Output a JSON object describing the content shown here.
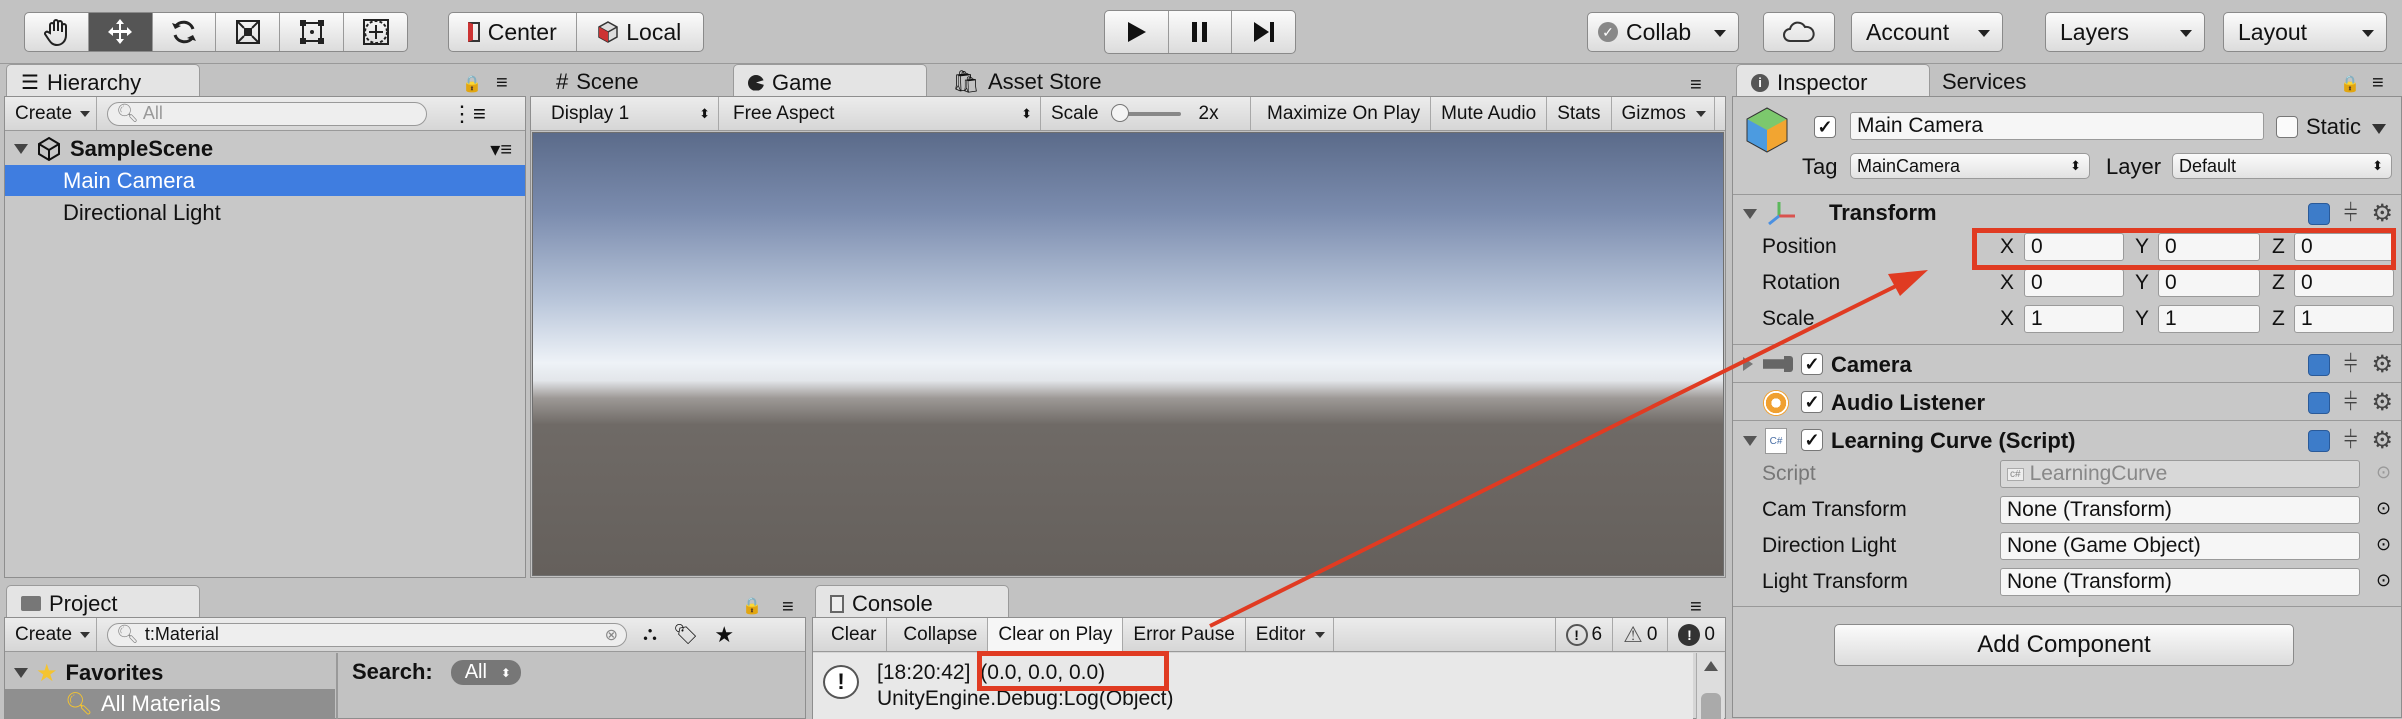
{
  "colors": {
    "accent": "#3f7de0",
    "highlight": "#e03b22"
  },
  "toolbar": {
    "tools": [
      "hand-tool-icon",
      "move-tool-icon",
      "rotate-tool-icon",
      "scale-tool-icon",
      "rect-tool-icon",
      "transform-tool-icon"
    ],
    "pivot_label": "Center",
    "space_label": "Local",
    "collab_label": "Collab",
    "account_label": "Account",
    "layers_label": "Layers",
    "layout_label": "Layout"
  },
  "hierarchy": {
    "tab": "Hierarchy",
    "create": "Create",
    "search_placeholder": "All",
    "scene": "SampleScene",
    "items": [
      "Main Camera",
      "Directional Light"
    ]
  },
  "view_tabs": {
    "scene": "Scene",
    "game": "Game",
    "asset_store": "Asset Store"
  },
  "game_toolbar": {
    "display": "Display 1",
    "aspect": "Free Aspect",
    "scale_label": "Scale",
    "scale_value": "2x",
    "maximize": "Maximize On Play",
    "mute": "Mute Audio",
    "stats": "Stats",
    "gizmos": "Gizmos"
  },
  "project": {
    "tab": "Project",
    "create": "Create",
    "search_value": "t:Material",
    "favorites": "Favorites",
    "all_materials": "All Materials",
    "search_label": "Search:",
    "search_scope": "All"
  },
  "console": {
    "tab": "Console",
    "clear": "Clear",
    "collapse": "Collapse",
    "clear_on_play": "Clear on Play",
    "error_pause": "Error Pause",
    "editor": "Editor",
    "info_count": "6",
    "warn_count": "0",
    "error_count": "0",
    "log_time": "[18:20:42]",
    "log_message": "(0.0, 0.0, 0.0)",
    "log_line2": "UnityEngine.Debug:Log(Object)"
  },
  "inspector": {
    "tab": "Inspector",
    "services_tab": "Services",
    "object_name": "Main Camera",
    "static_label": "Static",
    "tag_label": "Tag",
    "tag_value": "MainCamera",
    "layer_label": "Layer",
    "layer_value": "Default",
    "transform": {
      "title": "Transform",
      "rows": [
        {
          "label": "Position",
          "x": "0",
          "y": "0",
          "z": "0"
        },
        {
          "label": "Rotation",
          "x": "0",
          "y": "0",
          "z": "0"
        },
        {
          "label": "Scale",
          "x": "1",
          "y": "1",
          "z": "1"
        }
      ]
    },
    "camera_title": "Camera",
    "audio_title": "Audio Listener",
    "script_component": {
      "title": "Learning Curve (Script)",
      "script_label": "Script",
      "script_value": "LearningCurve",
      "fields": [
        {
          "label": "Cam Transform",
          "value": "None (Transform)"
        },
        {
          "label": "Direction Light",
          "value": "None (Game Object)"
        },
        {
          "label": "Light Transform",
          "value": "None (Transform)"
        }
      ]
    },
    "add_component": "Add Component"
  }
}
